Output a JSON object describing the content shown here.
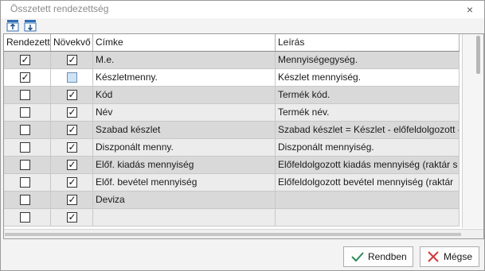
{
  "window": {
    "title": "Összetett rendezettség"
  },
  "grid": {
    "headers": {
      "sorted": "Rendezett",
      "ascending": "Növekvő",
      "label": "Címke",
      "description": "Leírás"
    },
    "rows": [
      {
        "sorted": true,
        "ascending": true,
        "label": "M.e.",
        "description": "Mennyiségegység."
      },
      {
        "sorted": true,
        "ascending": false,
        "label": "Készletmenny.",
        "description": "Készlet mennyiség."
      },
      {
        "sorted": false,
        "ascending": true,
        "label": "Kód",
        "description": "Termék kód."
      },
      {
        "sorted": false,
        "ascending": true,
        "label": "Név",
        "description": "Termék név."
      },
      {
        "sorted": false,
        "ascending": true,
        "label": "Szabad készlet",
        "description": "Szabad készlet = Készlet - előfeldolgozott -"
      },
      {
        "sorted": false,
        "ascending": true,
        "label": "Diszponált menny.",
        "description": "Diszponált mennyiség."
      },
      {
        "sorted": false,
        "ascending": true,
        "label": "Előf. kiadás mennyiség",
        "description": "Előfeldolgozott kiadás mennyiség (raktár s"
      },
      {
        "sorted": false,
        "ascending": true,
        "label": "Előf. bevétel mennyiség",
        "description": "Előfeldolgozott bevétel mennyiség (raktár"
      },
      {
        "sorted": false,
        "ascending": true,
        "label": "Deviza",
        "description": ""
      },
      {
        "sorted": false,
        "ascending": true,
        "label": "",
        "description": ""
      }
    ]
  },
  "buttons": {
    "ok": "Rendben",
    "cancel": "Mégse"
  },
  "colors": {
    "row_selected_bg": "#ffffff",
    "row_alt_bg": "#d9d9d9",
    "row_bg": "#ececec",
    "ok_icon": "#2e8b57",
    "cancel_icon": "#d23b3b"
  }
}
